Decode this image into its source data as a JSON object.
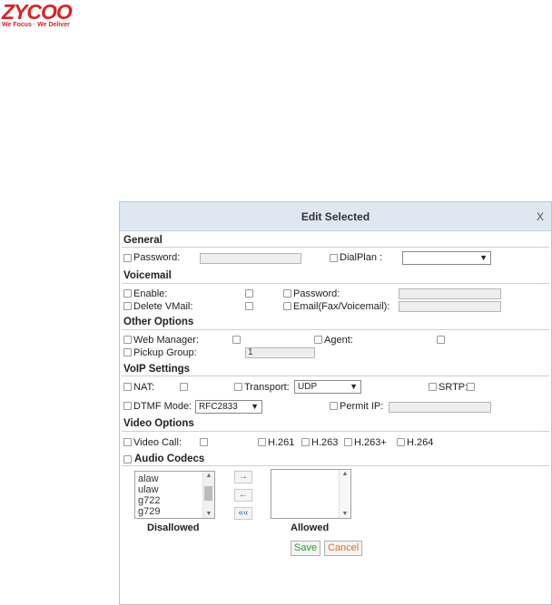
{
  "logo": {
    "name": "ZYCOO",
    "tagline": "We Focus · We Deliver"
  },
  "dialog": {
    "title": "Edit Selected",
    "close": "X",
    "general": {
      "heading": "General",
      "password": "Password:",
      "dialplan": "DialPlan :"
    },
    "voicemail": {
      "heading": "Voicemail",
      "enable": "Enable:",
      "password": "Password:",
      "delete_vmail": "Delete VMail:",
      "email": "Email(Fax/Voicemail):"
    },
    "other": {
      "heading": "Other Options",
      "web_manager": "Web Manager:",
      "agent": "Agent:",
      "pickup_group": "Pickup Group:",
      "pickup_value": "1"
    },
    "voip": {
      "heading": "VoIP Settings",
      "nat": "NAT:",
      "transport": "Transport:",
      "transport_value": "UDP",
      "srtp": "SRTP:",
      "dtmf": "DTMF Mode:",
      "dtmf_value": "RFC2833",
      "permit_ip": "Permit IP:"
    },
    "video": {
      "heading": "Video Options",
      "video_call": "Video Call:",
      "h261": "H.261",
      "h263": "H.263",
      "h263p": "H.263+",
      "h264": "H.264"
    },
    "audio": {
      "heading": "Audio Codecs",
      "codecs": [
        "alaw",
        "ulaw",
        "g722",
        "g729"
      ],
      "disallowed": "Disallowed",
      "allowed": "Allowed",
      "move_right": "→",
      "move_left": "←",
      "move_all_left": "««"
    },
    "save": "Save",
    "cancel": "Cancel"
  },
  "colors": {
    "brand": "#e02020",
    "titlebar": "#dfe8f0",
    "save_text": "#2e9a2e",
    "cancel_text": "#e07020"
  }
}
